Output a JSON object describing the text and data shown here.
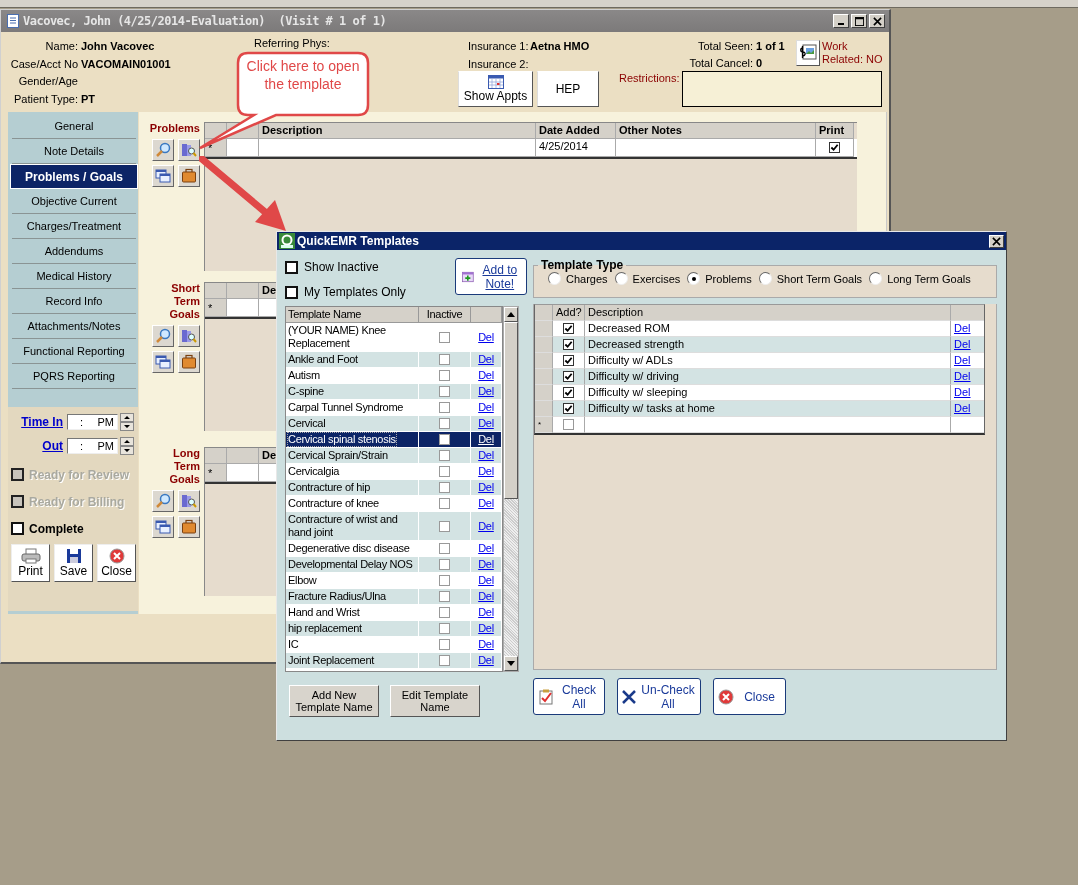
{
  "window": {
    "title": "Vacovec, John (4/25/2014-Evaluation)  (Visit # 1 of 1)"
  },
  "patient": {
    "name_label": "Name:",
    "name": "John Vacovec",
    "case_label": "Case/Acct No",
    "case": "VACOMAIN01001",
    "gender_label": "Gender/Age",
    "type_label": "Patient Type:",
    "type": "PT",
    "referring_label": "Referring Phys:",
    "insurance1_label": "Insurance 1:",
    "insurance1": "Aetna HMO",
    "insurance2_label": "Insurance 2:",
    "total_seen_label": "Total Seen:",
    "total_seen": "1 of 1",
    "total_cancel_label": "Total Cancel:",
    "total_cancel": "0",
    "work_related": "Work Related: NO",
    "restrictions_label": "Restrictions:"
  },
  "header_buttons": [
    "Show Appts",
    "HEP"
  ],
  "nav": [
    {
      "label": "General",
      "selected": false
    },
    {
      "label": "Note Details",
      "selected": false
    },
    {
      "label": "Problems / Goals",
      "selected": true
    },
    {
      "label": "Objective Current",
      "selected": false
    },
    {
      "label": "Charges/Treatment",
      "selected": false
    },
    {
      "label": "Addendums",
      "selected": false
    },
    {
      "label": "Medical History",
      "selected": false
    },
    {
      "label": "Record Info",
      "selected": false
    },
    {
      "label": "Attachments/Notes",
      "selected": false
    },
    {
      "label": "Functional Reporting",
      "selected": false
    },
    {
      "label": "PQRS Reporting",
      "selected": false
    }
  ],
  "times": [
    {
      "label": "Time In",
      "value": ":",
      "period": "PM"
    },
    {
      "label": "Out",
      "value": ":",
      "period": "PM"
    }
  ],
  "status_checks": [
    {
      "label": "Ready for Review",
      "checked": false,
      "disabled": true
    },
    {
      "label": "Ready for Billing",
      "checked": false,
      "disabled": true
    },
    {
      "label": "Complete",
      "checked": false,
      "disabled": false
    }
  ],
  "actions": [
    "Print",
    "Save",
    "Close"
  ],
  "sections": [
    {
      "title": "Problems",
      "columns": [
        "Description",
        "Date Added",
        "Other Notes",
        "Print"
      ],
      "row": {
        "marker": "*",
        "date_added": "4/25/2014",
        "print": true
      }
    },
    {
      "title": "Short Term Goals",
      "columns": [
        "De"
      ],
      "row": {
        "marker": "*"
      }
    },
    {
      "title": "Long Term Goals",
      "columns": [
        "De"
      ],
      "row": {
        "marker": "*"
      }
    }
  ],
  "callout": {
    "text": "Click here to open the template"
  },
  "dialog": {
    "title": "QuickEMR Templates",
    "filters": [
      {
        "label": "Show Inactive",
        "checked": false
      },
      {
        "label": "My Templates Only",
        "checked": false
      }
    ],
    "add_to_note": "Add to Note!",
    "template_type": {
      "label": "Template Type",
      "options": [
        {
          "label": "Charges",
          "selected": false
        },
        {
          "label": "Exercises",
          "selected": false
        },
        {
          "label": "Problems",
          "selected": true
        },
        {
          "label": "Short Term Goals",
          "selected": false
        },
        {
          "label": "Long Term Goals",
          "selected": false
        }
      ]
    },
    "templates": {
      "columns": [
        "Template Name",
        "Inactive"
      ],
      "rows": [
        {
          "name": "(YOUR NAME) Knee Replacement",
          "inactive": false,
          "selected": false,
          "action": "Del"
        },
        {
          "name": "Ankle and Foot",
          "inactive": false,
          "selected": false,
          "action": "Del"
        },
        {
          "name": "Autism",
          "inactive": false,
          "selected": false,
          "action": "Del"
        },
        {
          "name": "C-spine",
          "inactive": false,
          "selected": false,
          "action": "Del"
        },
        {
          "name": "Carpal Tunnel Syndrome",
          "inactive": false,
          "selected": false,
          "action": "Del"
        },
        {
          "name": "Cervical",
          "inactive": false,
          "selected": false,
          "action": "Del"
        },
        {
          "name": "Cervical spinal stenosis",
          "inactive": false,
          "selected": true,
          "action": "Del"
        },
        {
          "name": "Cervical Sprain/Strain",
          "inactive": false,
          "selected": false,
          "action": "Del"
        },
        {
          "name": "Cervicalgia",
          "inactive": false,
          "selected": false,
          "action": "Del"
        },
        {
          "name": "Contracture of hip",
          "inactive": false,
          "selected": false,
          "action": "Del"
        },
        {
          "name": "Contracture of knee",
          "inactive": false,
          "selected": false,
          "action": "Del"
        },
        {
          "name": "Contracture of wrist and hand joint",
          "inactive": false,
          "selected": false,
          "action": "Del"
        },
        {
          "name": "Degenerative disc disease",
          "inactive": false,
          "selected": false,
          "action": "Del"
        },
        {
          "name": "Developmental Delay NOS",
          "inactive": false,
          "selected": false,
          "action": "Del"
        },
        {
          "name": "Elbow",
          "inactive": false,
          "selected": false,
          "action": "Del"
        },
        {
          "name": "Fracture Radius/Ulna",
          "inactive": false,
          "selected": false,
          "action": "Del"
        },
        {
          "name": "Hand and Wrist",
          "inactive": false,
          "selected": false,
          "action": "Del"
        },
        {
          "name": "hip replacement",
          "inactive": false,
          "selected": false,
          "action": "Del"
        },
        {
          "name": "IC",
          "inactive": false,
          "selected": false,
          "action": "Del"
        },
        {
          "name": "Joint Replacement",
          "inactive": false,
          "selected": false,
          "action": "Del"
        }
      ]
    },
    "items": {
      "columns": [
        "Add?",
        "Description"
      ],
      "rows": [
        {
          "add": true,
          "description": "Decreased ROM",
          "action": "Del"
        },
        {
          "add": true,
          "description": "Decreased strength",
          "action": "Del"
        },
        {
          "add": true,
          "description": "Difficulty w/ ADLs",
          "action": "Del"
        },
        {
          "add": true,
          "description": "Difficulty w/ driving",
          "action": "Del"
        },
        {
          "add": true,
          "description": "Difficulty w/ sleeping",
          "action": "Del"
        },
        {
          "add": true,
          "description": "Difficulty w/ tasks at home",
          "action": "Del"
        }
      ],
      "new_row": {
        "marker": "*",
        "add": false
      }
    },
    "template_buttons": [
      "Add New Template Name",
      "Edit Template Name"
    ],
    "item_buttons": [
      "Check All",
      "Un-Check All",
      "Close"
    ]
  }
}
